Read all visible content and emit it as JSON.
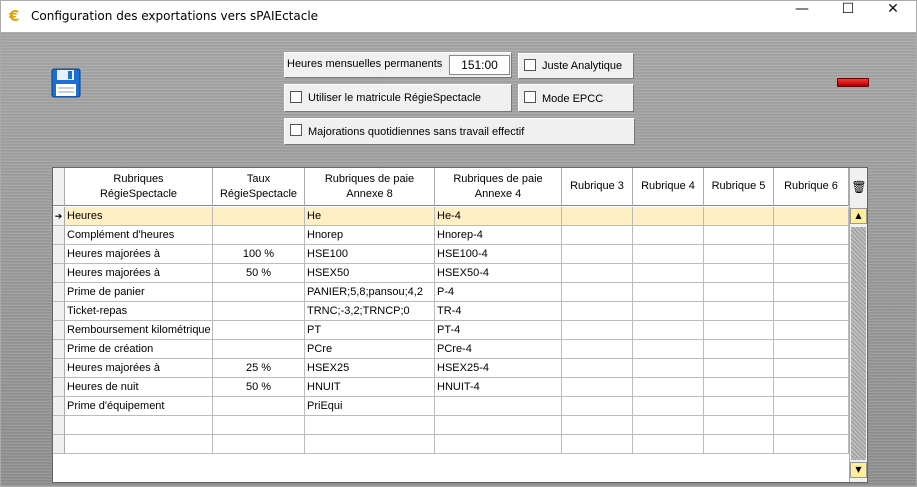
{
  "window": {
    "app_icon": "€",
    "title": "Configuration des exportations vers sPAIEctacle",
    "minimize": "—",
    "maximize": "☐",
    "close": "✕"
  },
  "options": {
    "heures_label": "Heures mensuelles permanents",
    "heures_value": "151:00",
    "juste_analytique": {
      "label": "Juste Analytique",
      "checked": false
    },
    "utiliser_matricule": {
      "label": "Utiliser le matricule RégieSpectacle",
      "checked": false
    },
    "mode_epcc": {
      "label": "Mode EPCC",
      "checked": false
    },
    "majorations": {
      "label": "Majorations quotidiennes sans travail effectif",
      "checked": false
    }
  },
  "grid": {
    "columns": [
      "Rubriques\nRégieSpectacle",
      "Taux\nRégieSpectacle",
      "Rubriques de paie\nAnnexe 8",
      "Rubriques de paie\nAnnexe 4",
      "Rubrique 3",
      "Rubrique 4",
      "Rubrique 5",
      "Rubrique 6"
    ],
    "current_row_marker": "➔",
    "rows": [
      [
        "Heures",
        "",
        "He",
        "He-4",
        "",
        "",
        "",
        ""
      ],
      [
        "Complément d'heures",
        "",
        "Hnorep",
        "Hnorep-4",
        "",
        "",
        "",
        ""
      ],
      [
        "Heures majorées à",
        "100 %",
        "HSE100",
        "HSE100-4",
        "",
        "",
        "",
        ""
      ],
      [
        "Heures majorées à",
        "50 %",
        "HSEX50",
        "HSEX50-4",
        "",
        "",
        "",
        ""
      ],
      [
        "Prime de panier",
        "",
        "PANIER;5,8;pansou;4,2",
        "P-4",
        "",
        "",
        "",
        ""
      ],
      [
        "Ticket-repas",
        "",
        "TRNC;-3,2;TRNCP;0",
        "TR-4",
        "",
        "",
        "",
        ""
      ],
      [
        "Remboursement kilométrique",
        "",
        "PT",
        "PT-4",
        "",
        "",
        "",
        ""
      ],
      [
        "Prime de création",
        "",
        "PCre",
        "PCre-4",
        "",
        "",
        "",
        ""
      ],
      [
        "Heures majorées à",
        "25 %",
        "HSEX25",
        "HSEX25-4",
        "",
        "",
        "",
        ""
      ],
      [
        "Heures de nuit",
        "50 %",
        "HNUIT",
        "HNUIT-4",
        "",
        "",
        "",
        ""
      ],
      [
        "Prime d'équipement",
        "",
        "PriEqui",
        "",
        "",
        "",
        "",
        ""
      ],
      [
        "",
        "",
        "",
        "",
        "",
        "",
        "",
        ""
      ],
      [
        "",
        "",
        "",
        "",
        "",
        "",
        "",
        ""
      ]
    ],
    "selected_row": 0,
    "delete_icon": "🗑",
    "scroll_up": "▲",
    "scroll_down": "▼"
  }
}
